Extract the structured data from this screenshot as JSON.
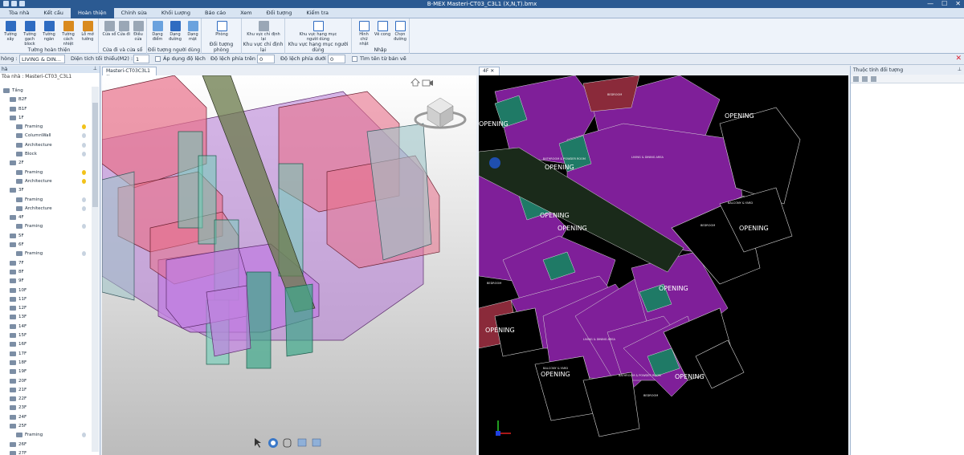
{
  "window": {
    "title": "B-MEX Masteri-CT03_C3L1 (X,N,T).bmx",
    "minimize": "—",
    "maximize": "☐",
    "close": "✕"
  },
  "ribbon_tabs": [
    "Tòa nhà",
    "Kết cấu",
    "Hoàn thiện",
    "Chỉnh sửa",
    "Khối Lượng",
    "Báo cáo",
    "Xem",
    "Đối tượng",
    "Kiểm tra"
  ],
  "ribbon": {
    "group1": {
      "name": "Tường hoàn thiện",
      "buttons": [
        "Tường xây",
        "Tường gạch block",
        "Tường ngăn",
        "Tường cách nhiệt",
        "Lỗ mở tường"
      ]
    },
    "group2": {
      "name": "Cửa đi và cửa sổ",
      "buttons": [
        "Cửa sổ",
        "Cửa đi",
        "Điều cửa"
      ]
    },
    "group3": {
      "name": "Đối tượng người dùng",
      "buttons": [
        "Dạng điểm",
        "Dạng đường",
        "Dạng mặt"
      ]
    },
    "group4": {
      "name": "Đối tượng phòng",
      "buttons": [
        "Phòng"
      ]
    },
    "group5": {
      "name": "Khu vực chỉ định lại",
      "buttons": [
        "Khu vực chỉ định lại"
      ]
    },
    "group6": {
      "name": "Khu vực hạng mục người dùng",
      "buttons": [
        "Khu vực hạng mục người dùng"
      ]
    },
    "group7": {
      "name": "Nhập",
      "buttons": [
        "Hình chữ nhật",
        "Vẽ cong",
        "Chọn đường"
      ]
    }
  },
  "filterbar": {
    "room_label": "hòng :",
    "room_value": "LIVING & DIN...",
    "min_area_label": "Diện tích tối thiểu(M2) :",
    "min_area_value": "1",
    "apply_offset_label": "Áp dụng độ lệch",
    "top_offset_label": "Độ lệch phía trên :",
    "top_offset_value": "0",
    "bottom_offset_label": "Độ lệch phía dưới :",
    "bottom_offset_value": "0",
    "find_name_label": "Tìm tên từ bản vẽ"
  },
  "left_panel": {
    "header": "hà",
    "path": "Tòa nhà : Masteri-CT03_C3L1",
    "tree": [
      {
        "label": "Tầng",
        "indent": 0,
        "bulb": ""
      },
      {
        "label": "B2F",
        "indent": 1,
        "bulb": ""
      },
      {
        "label": "B1F",
        "indent": 1,
        "bulb": ""
      },
      {
        "label": "1F",
        "indent": 1,
        "bulb": ""
      },
      {
        "label": "Framing",
        "indent": 2,
        "bulb": "on"
      },
      {
        "label": "ColumnWall",
        "indent": 2,
        "bulb": "off"
      },
      {
        "label": "Architecture",
        "indent": 2,
        "bulb": "off"
      },
      {
        "label": "Block",
        "indent": 2,
        "bulb": "off"
      },
      {
        "label": "2F",
        "indent": 1,
        "bulb": ""
      },
      {
        "label": "Framing",
        "indent": 2,
        "bulb": "on"
      },
      {
        "label": "Architecture",
        "indent": 2,
        "bulb": "on"
      },
      {
        "label": "3F",
        "indent": 1,
        "bulb": ""
      },
      {
        "label": "Framing",
        "indent": 2,
        "bulb": "off"
      },
      {
        "label": "Architecture",
        "indent": 2,
        "bulb": "off"
      },
      {
        "label": "4F",
        "indent": 1,
        "bulb": ""
      },
      {
        "label": "Framing",
        "indent": 2,
        "bulb": "off"
      },
      {
        "label": "5F",
        "indent": 1,
        "bulb": ""
      },
      {
        "label": "6F",
        "indent": 1,
        "bulb": ""
      },
      {
        "label": "Framing",
        "indent": 2,
        "bulb": "off"
      },
      {
        "label": "7F",
        "indent": 1,
        "bulb": ""
      },
      {
        "label": "8F",
        "indent": 1,
        "bulb": ""
      },
      {
        "label": "9F",
        "indent": 1,
        "bulb": ""
      },
      {
        "label": "10F",
        "indent": 1,
        "bulb": ""
      },
      {
        "label": "11F",
        "indent": 1,
        "bulb": ""
      },
      {
        "label": "12F",
        "indent": 1,
        "bulb": ""
      },
      {
        "label": "13F",
        "indent": 1,
        "bulb": ""
      },
      {
        "label": "14F",
        "indent": 1,
        "bulb": ""
      },
      {
        "label": "15F",
        "indent": 1,
        "bulb": ""
      },
      {
        "label": "16F",
        "indent": 1,
        "bulb": ""
      },
      {
        "label": "17F",
        "indent": 1,
        "bulb": ""
      },
      {
        "label": "18F",
        "indent": 1,
        "bulb": ""
      },
      {
        "label": "19F",
        "indent": 1,
        "bulb": ""
      },
      {
        "label": "20F",
        "indent": 1,
        "bulb": ""
      },
      {
        "label": "21F",
        "indent": 1,
        "bulb": ""
      },
      {
        "label": "22F",
        "indent": 1,
        "bulb": ""
      },
      {
        "label": "23F",
        "indent": 1,
        "bulb": ""
      },
      {
        "label": "24F",
        "indent": 1,
        "bulb": ""
      },
      {
        "label": "25F",
        "indent": 1,
        "bulb": ""
      },
      {
        "label": "Framing",
        "indent": 2,
        "bulb": "off"
      },
      {
        "label": "26F",
        "indent": 1,
        "bulb": ""
      },
      {
        "label": "27F",
        "indent": 1,
        "bulb": ""
      }
    ]
  },
  "doc_tabs": {
    "tab3d": "Masteri-CT03C3L1",
    "tabplan": "4F"
  },
  "plan_labels": {
    "opening": "OPENING",
    "bedroom": "BEDROOM",
    "balcony": "BALCONY & YARD",
    "living": "LIVING & DINING AREA",
    "bathroom": "BATHROOM & POWDER ROOM"
  },
  "right_panel": {
    "header": "Thuộc tính đối tượng"
  },
  "colors": {
    "accent": "#2b5a92",
    "magenta": "#a050c8",
    "pink": "#e0607a",
    "teal": "#2fa080",
    "plan_magenta": "#7f1f99"
  }
}
